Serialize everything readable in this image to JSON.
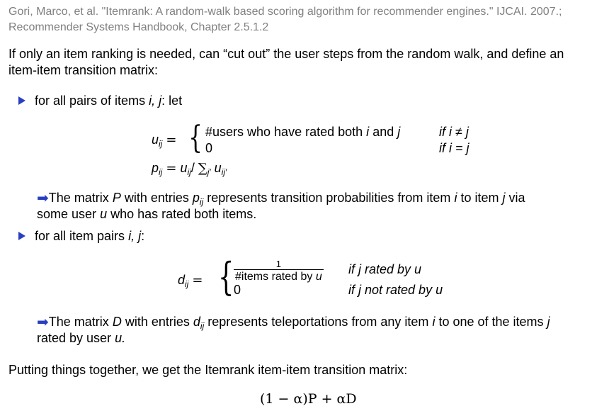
{
  "reference": {
    "line1": "Gori, Marco, et al. \"Itemrank: A random-walk based scoring algorithm for recommender engines.\" IJCAI. 2007.;",
    "line2": "Recommender Systems Handbook, Chapter 2.5.1.2"
  },
  "intro": {
    "line1": "If only an item ranking is needed, can “cut out” the user steps from the random walk, and define an",
    "line2": "item-item transition matrix:"
  },
  "bullet1": {
    "text": "for all pairs of items",
    "vars": "i, j",
    "tail": ": let"
  },
  "u_def": {
    "case1_text": "#users who have rated both",
    "case1_i": "i",
    "case1_and": "and",
    "case1_j": "j",
    "cond1": "if i ≠ j",
    "case2_val": "0",
    "cond2": "if i = j"
  },
  "p_def": "p_ij = u_ij / Σ_j' u_ij'",
  "note1": {
    "pre": "The matrix",
    "P": "P",
    "mid": "with entries",
    "p": "p",
    "rest": "represents transition probabilities from item",
    "i": "i",
    "to": "to item",
    "j": "j",
    "via": "via",
    "line2_pre": "some user",
    "u": "u",
    "line2_post": "who has rated both items."
  },
  "bullet2": {
    "text": "for all item pairs",
    "vars": "i, j",
    "tail": ":"
  },
  "d_def": {
    "num": "1",
    "den": "#items rated by",
    "den_u": "u",
    "cond1": "if j rated by u",
    "case2_val": "0",
    "cond2": "if j not rated by u"
  },
  "note2": {
    "pre": "The matrix",
    "D": "D",
    "mid": "with entries",
    "d": "d",
    "rest": "represents teleportations from any item",
    "i": "i",
    "to": "to one of the items",
    "j": "j",
    "line2_pre": "rated by user",
    "u": "u."
  },
  "conclusion": "Putting things together, we get the Itemrank item-item transition matrix:",
  "final_formula": "(1 − α)P + αD",
  "colors": {
    "bullet": "#2a3fbf",
    "reference": "#808080"
  },
  "icons": [
    "triangle-bullet-icon",
    "arrow-right-icon"
  ]
}
